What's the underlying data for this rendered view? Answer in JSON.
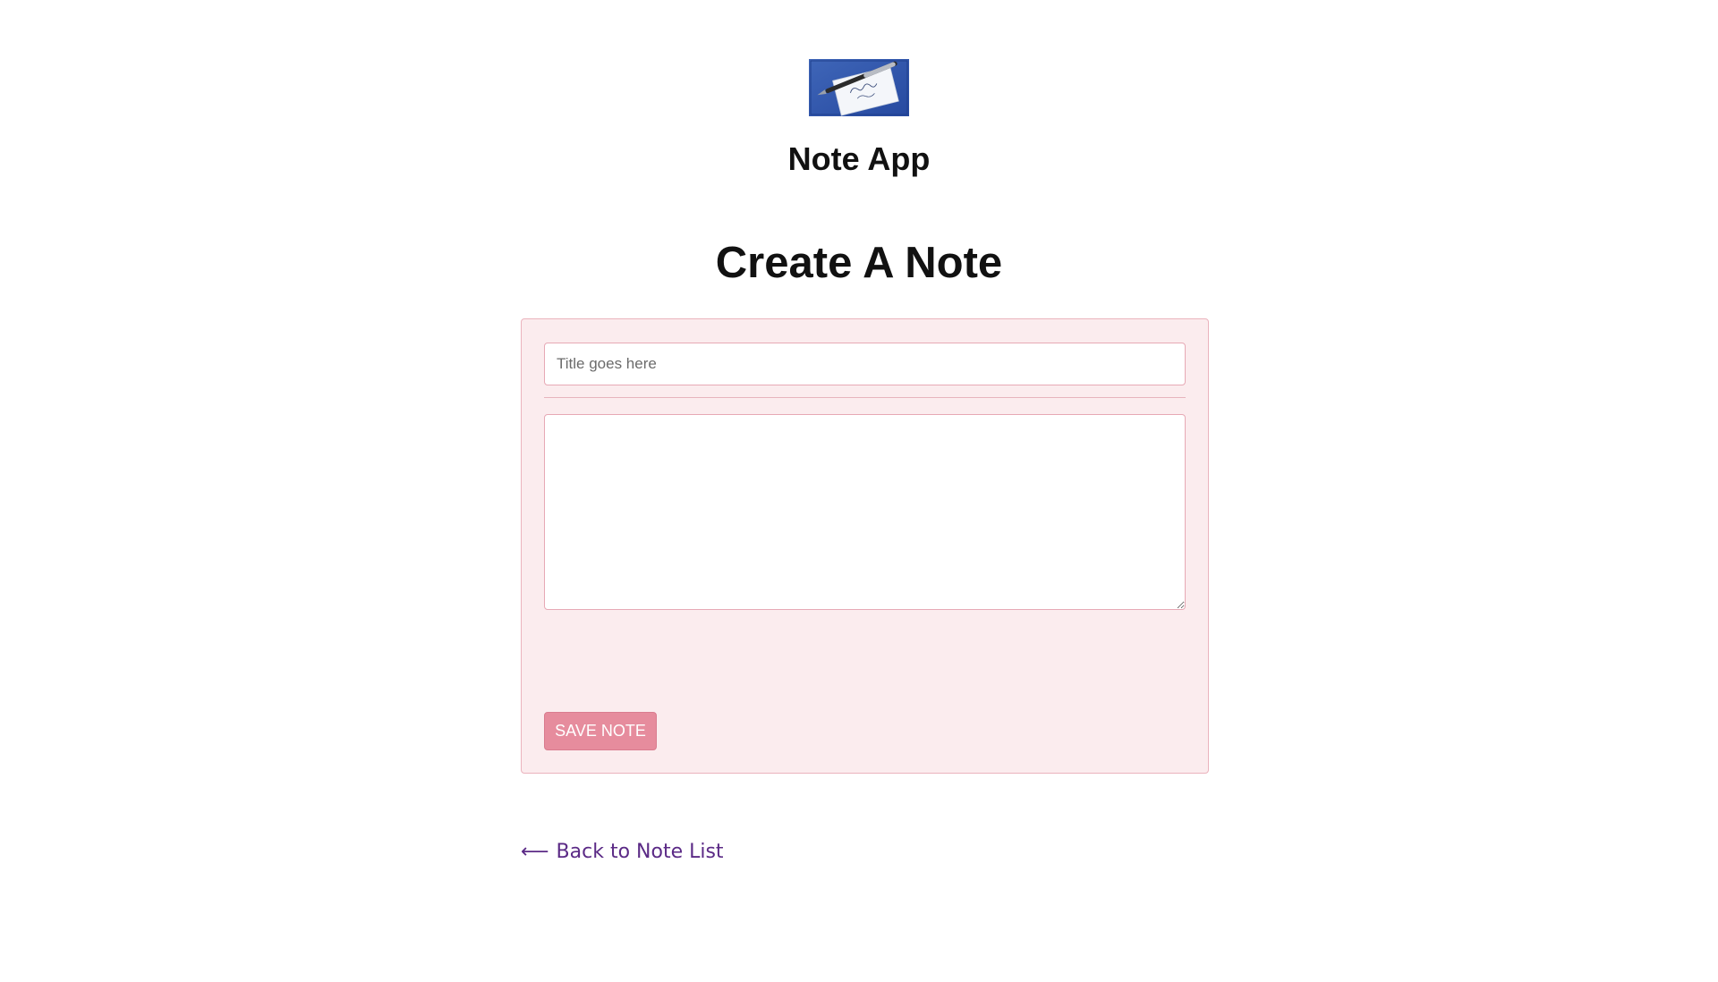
{
  "header": {
    "logo_icon": "note-envelope-pen-image",
    "app_title": "Note App"
  },
  "main": {
    "page_title": "Create A Note",
    "form": {
      "title_placeholder": "Title goes here",
      "title_value": "",
      "body_value": "",
      "save_label": "SAVE NOTE"
    }
  },
  "footer": {
    "back_arrow": "⟵",
    "back_label": "Back to Note List"
  },
  "colors": {
    "card_background": "#fbecee",
    "card_border": "#ebb3bd",
    "save_button": "#e68c9d",
    "link": "#5b2a86"
  }
}
